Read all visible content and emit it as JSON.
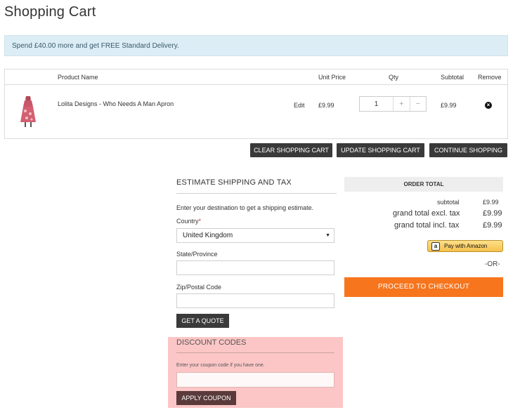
{
  "page": {
    "title": "Shopping Cart"
  },
  "notice": {
    "text": "Spend £40.00 more and get FREE Standard Delivery."
  },
  "cart": {
    "headers": {
      "product_name": "Product Name",
      "unit_price": "Unit Price",
      "qty": "Qty",
      "subtotal": "Subtotal",
      "remove": "Remove"
    },
    "items": [
      {
        "name": "Lolita Designs - Who Needs A Man Apron",
        "edit": "Edit",
        "unit_price": "£9.99",
        "qty": "1",
        "subtotal": "£9.99",
        "plus": "+",
        "minus": "−",
        "remove_icon": "close-circle-icon"
      }
    ]
  },
  "actions": {
    "clear": "CLEAR SHOPPING CART",
    "update": "UPDATE SHOPPING CART",
    "continue": "CONTINUE SHOPPING"
  },
  "shipping": {
    "title": "ESTIMATE SHIPPING AND TAX",
    "intro": "Enter your destination to get a shipping estimate.",
    "country_label": "Country",
    "required_mark": "*",
    "country_value": "United Kingdom",
    "state_label": "State/Province",
    "state_value": "",
    "zip_label": "Zip/Postal Code",
    "zip_value": "",
    "quote_button": "GET A QUOTE"
  },
  "discount": {
    "title": "DISCOUNT CODES",
    "hint": "Enter your coupon code if you have one.",
    "code_value": "",
    "apply_button": "APPLY COUPON",
    "highlight_color": "#fcc6c6"
  },
  "order_total": {
    "title": "ORDER TOTAL",
    "subtotal_label": "subtotal",
    "subtotal_value": "£9.99",
    "excl_label": "grand total excl. tax",
    "excl_value": "£9.99",
    "incl_label": "grand total incl. tax",
    "incl_value": "£9.99",
    "amazon_button": "Pay with Amazon",
    "amazon_icon": "a",
    "or_text": "-OR-",
    "checkout_button": "PROCEED TO CHECKOUT",
    "checkout_color": "#f7751d"
  }
}
